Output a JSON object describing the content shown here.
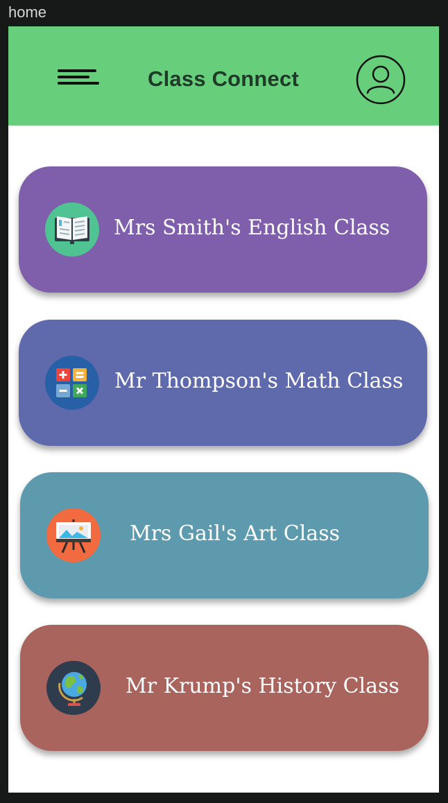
{
  "window": {
    "title": "home"
  },
  "app_bar": {
    "title": "Class Connect",
    "menu_icon": "hamburger-menu-icon",
    "profile_icon": "user-profile-icon",
    "background": "#67cf7b"
  },
  "classes": [
    {
      "label": "Mrs Smith's English Class",
      "icon": "open-book-icon",
      "color": "#7f5fab"
    },
    {
      "label": "Mr Thompson's Math Class",
      "icon": "calculator-icon",
      "color": "#5f6aac"
    },
    {
      "label": "Mrs Gail's Art Class",
      "icon": "easel-icon",
      "color": "#5e9aad"
    },
    {
      "label": "Mr Krump's History Class",
      "icon": "globe-icon",
      "color": "#a8645d"
    }
  ]
}
